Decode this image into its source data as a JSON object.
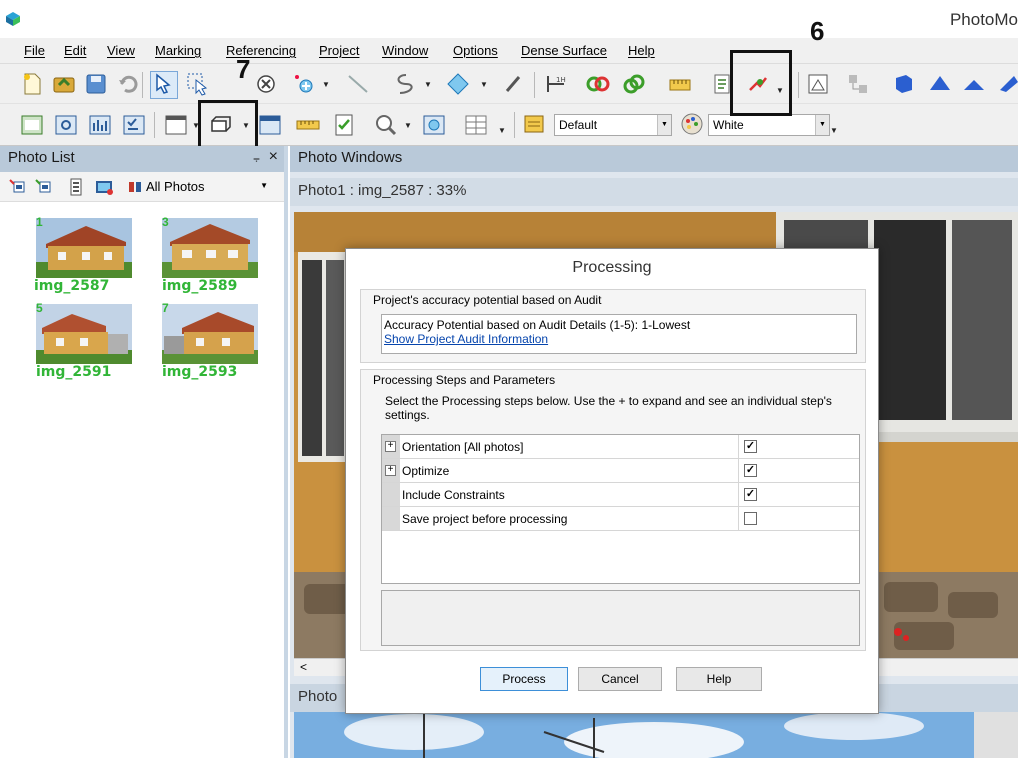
{
  "app": {
    "title": "PhotoMo"
  },
  "menu": [
    "File",
    "Edit",
    "View",
    "Marking",
    "Referencing",
    "Project",
    "Window",
    "Options",
    "Dense Surface",
    "Help"
  ],
  "toolbar2": {
    "appearance_combo": "Default",
    "color_combo": "White"
  },
  "callouts": {
    "seven": "7",
    "six": "6"
  },
  "photo_list": {
    "title": "Photo List",
    "filter": "All Photos",
    "pin": "⨪",
    "close": "×",
    "photos": [
      {
        "num": "1",
        "name": "img_2587"
      },
      {
        "num": "3",
        "name": "img_2589"
      },
      {
        "num": "5",
        "name": "img_2591"
      },
      {
        "num": "7",
        "name": "img_2593"
      }
    ]
  },
  "photo_windows": {
    "title": "Photo Windows",
    "photo1_tab": "Photo1 : img_2587 : 33%",
    "photo2_header": "Photo",
    "scroll_left": "<"
  },
  "dialog": {
    "title": "Processing",
    "accuracy_legend": "Project's accuracy potential based on Audit",
    "accuracy_text": "Accuracy Potential based on Audit Details (1-5): 1-Lowest",
    "audit_link": "Show Project Audit Information",
    "steps_legend": "Processing Steps and Parameters",
    "steps_desc": "Select the Processing steps below. Use the + to expand and see an individual step's settings.",
    "steps": [
      {
        "label": "Orientation [All photos]",
        "expandable": true,
        "checked": true,
        "mark": "✓"
      },
      {
        "label": "Optimize",
        "expandable": true,
        "checked": true,
        "mark": "✓"
      },
      {
        "label": "Include Constraints",
        "expandable": false,
        "checked": true,
        "mark": "✓"
      },
      {
        "label": "Save project before processing",
        "expandable": false,
        "checked": false,
        "mark": ""
      }
    ],
    "buttons": {
      "process": "Process",
      "cancel": "Cancel",
      "help": "Help"
    }
  }
}
